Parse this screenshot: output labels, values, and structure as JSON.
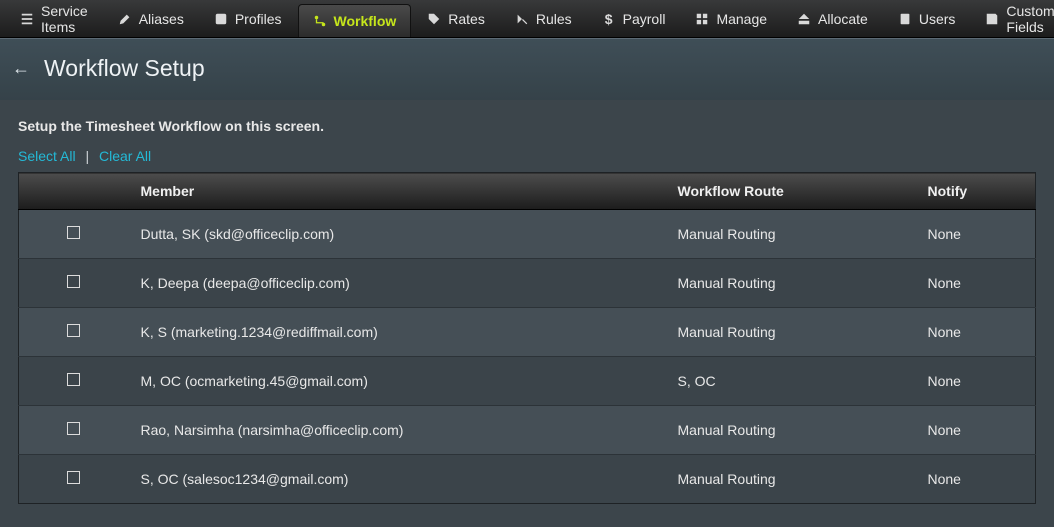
{
  "nav": {
    "items": [
      {
        "label": "Service Items",
        "icon": "list"
      },
      {
        "label": "Aliases",
        "icon": "pencil"
      },
      {
        "label": "Profiles",
        "icon": "profile"
      },
      {
        "label": "Workflow",
        "icon": "flow",
        "active": true
      },
      {
        "label": "Rates",
        "icon": "tag"
      },
      {
        "label": "Rules",
        "icon": "hammer"
      },
      {
        "label": "Payroll",
        "icon": "dollar"
      },
      {
        "label": "Manage",
        "icon": "grid"
      },
      {
        "label": "Allocate",
        "icon": "allocate"
      },
      {
        "label": "Users",
        "icon": "users"
      },
      {
        "label": "Custom Fields",
        "icon": "save"
      }
    ]
  },
  "page": {
    "title": "Workflow Setup",
    "instruction": "Setup the Timesheet Workflow on this screen.",
    "select_all": "Select All",
    "clear_all": "Clear All"
  },
  "table": {
    "headers": {
      "member": "Member",
      "route": "Workflow Route",
      "notify": "Notify"
    },
    "rows": [
      {
        "member": "Dutta, SK (skd@officeclip.com)",
        "route": "Manual Routing",
        "notify": "None"
      },
      {
        "member": "K, Deepa (deepa@officeclip.com)",
        "route": "Manual Routing",
        "notify": "None"
      },
      {
        "member": "K, S (marketing.1234@rediffmail.com)",
        "route": "Manual Routing",
        "notify": "None"
      },
      {
        "member": "M, OC (ocmarketing.45@gmail.com)",
        "route": "S, OC",
        "notify": "None"
      },
      {
        "member": "Rao, Narsimha (narsimha@officeclip.com)",
        "route": "Manual Routing",
        "notify": "None"
      },
      {
        "member": "S, OC (salesoc1234@gmail.com)",
        "route": "Manual Routing",
        "notify": "None"
      }
    ]
  }
}
